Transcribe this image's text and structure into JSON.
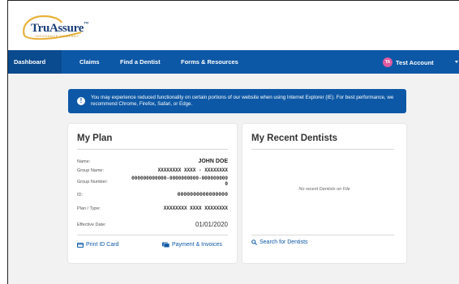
{
  "brand": {
    "logo_text": "TruAssure",
    "logo_tm": "™",
    "logo_sub": "INSURANCE COMPANY"
  },
  "nav": {
    "items": [
      {
        "label": "Dashboard",
        "active": true
      },
      {
        "label": "Claims"
      },
      {
        "label": "Find a Dentist"
      },
      {
        "label": "Forms & Resources"
      }
    ],
    "account": {
      "initials": "TA",
      "name": "Test Account"
    }
  },
  "alert": {
    "text": "You may experience reduced functionality on certain portions of our website when using Internet Explorer (IE). For best performance, we recommend Chrome, Firefox, Safari, or Edge."
  },
  "plan": {
    "title": "My Plan",
    "rows": [
      {
        "label": "Name:",
        "value": "JOHN DOE"
      },
      {
        "label": "Group Name:",
        "value": "XXXXXXXX XXXX - XXXXXXXX"
      },
      {
        "label": "Group Number:",
        "value": "000000000000-0000000000-0000000000"
      },
      {
        "label": "ID:",
        "value": "0000000000000000"
      },
      {
        "label": "Plan / Type:",
        "value": "XXXXXXXX XXXX XXXXXXXX"
      },
      {
        "label": "Effective Date:",
        "value": "01/01/2020"
      }
    ],
    "print_link": "Print ID Card",
    "payment_link": "Payment & Invoices"
  },
  "dentists": {
    "title": "My Recent Dentists",
    "empty": "No recent Dentists on File",
    "search_link": "Search for Dentists"
  },
  "colors": {
    "primary": "#0d58a6",
    "avatar": "#e05aa0"
  }
}
